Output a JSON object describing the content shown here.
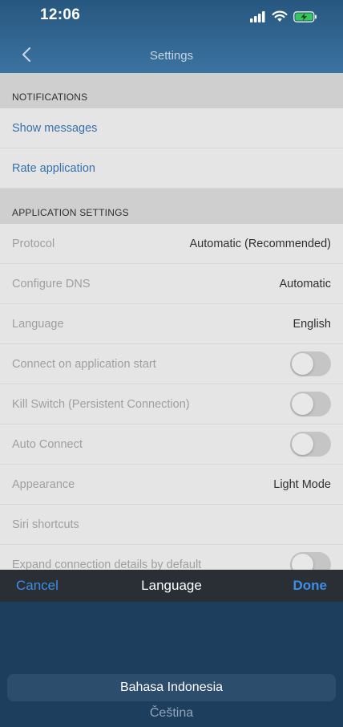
{
  "status_bar": {
    "time": "12:06"
  },
  "nav": {
    "title": "Settings",
    "back_icon": "chevron-left-icon"
  },
  "sections": {
    "notifications": {
      "header": "NOTIFICATIONS",
      "show_messages": "Show messages",
      "rate_application": "Rate application"
    },
    "app_settings": {
      "header": "APPLICATION SETTINGS",
      "protocol": {
        "label": "Protocol",
        "value": "Automatic (Recommended)"
      },
      "dns": {
        "label": "Configure DNS",
        "value": "Automatic"
      },
      "language": {
        "label": "Language",
        "value": "English"
      },
      "connect_on_start": {
        "label": "Connect on application start",
        "on": false
      },
      "kill_switch": {
        "label": "Kill Switch (Persistent Connection)",
        "on": false
      },
      "auto_connect": {
        "label": "Auto Connect",
        "on": false
      },
      "appearance": {
        "label": "Appearance",
        "value": "Light Mode"
      },
      "siri": {
        "label": "Siri shortcuts"
      },
      "expand_details": {
        "label": "Expand connection details by default",
        "on": false
      }
    }
  },
  "picker": {
    "cancel": "Cancel",
    "title": "Language",
    "done": "Done",
    "selected": "Bahasa Indonesia",
    "next": "Čeština"
  },
  "colors": {
    "header": "#3b73a0",
    "link": "#3b78b5",
    "picker_bg": "#1e3e5e",
    "toolbar_action": "#3d8ee6"
  }
}
